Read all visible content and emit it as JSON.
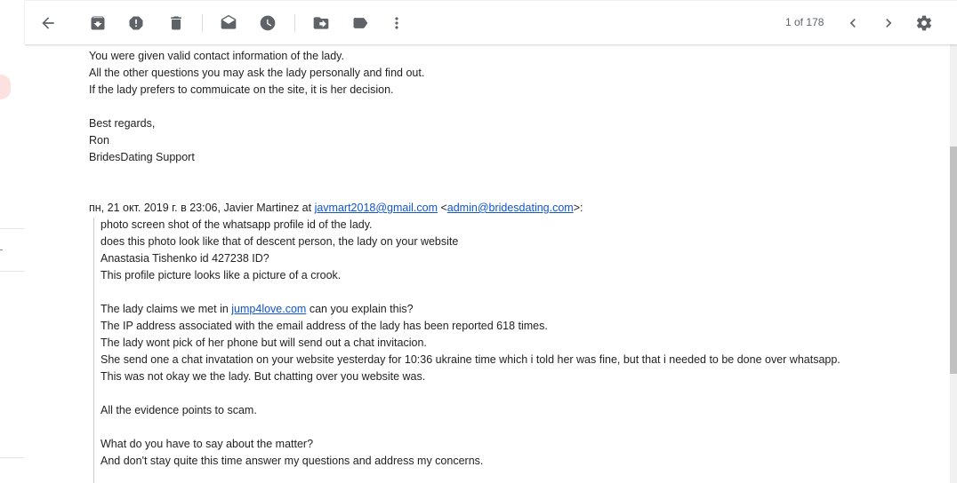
{
  "toolbar": {
    "icons": [
      "back-arrow-icon",
      "archive-icon",
      "report-spam-icon",
      "delete-icon",
      "mark-unread-icon",
      "snooze-icon",
      "move-to-icon",
      "label-icon",
      "more-vert-icon"
    ],
    "pager_text": "1 of 178",
    "settings_icon": "gear-icon"
  },
  "email": {
    "reply_lines": [
      "You were given valid contact information of the lady.",
      "All the other questions you may ask the lady personally and find out.",
      "If the lady prefers to commuicate on the site, it is her decision.",
      "Best regards,",
      "Ron",
      "BridesDating Support"
    ],
    "quote_header": {
      "prefix": "пн, 21 окт. 2019 г. в 23:06, Javier Martinez at ",
      "sender_email": "javmart2018@gmail.com",
      "middle": " <",
      "recipient_email": "admin@bridesdating.com",
      "suffix": ">:"
    },
    "quoted_lines": [
      "photo screen shot of the whatsapp profile id of the lady.",
      "does this photo look like that of descent person, the lady on your website",
      "Anastasia Tishenko id 427238 ID?",
      "This profile picture looks like a picture of a crook."
    ],
    "jump_line": {
      "prefix": "The lady claims we met in ",
      "link": "jump4love.com",
      "suffix": " can you explain this?"
    },
    "quoted_lines_2": [
      "The IP address associated with the email address of the lady has been reported 618 times.",
      "The lady wont pick of her phone but will send out a chat invitacion.",
      "She send one a chat invatation on your website yesterday for 10:36 ukraine time which i told her was fine, but that i needed to be done over whatsapp.",
      "This was not okay we the lady. But chatting over you website was.",
      "All the evidence points to scam.",
      "What do you have to say about the matter?",
      "And don't stay quite this time answer my questions and address my concerns."
    ]
  },
  "colors": {
    "link": "#1155cc",
    "icon": "#5f6368",
    "text": "#222222"
  }
}
